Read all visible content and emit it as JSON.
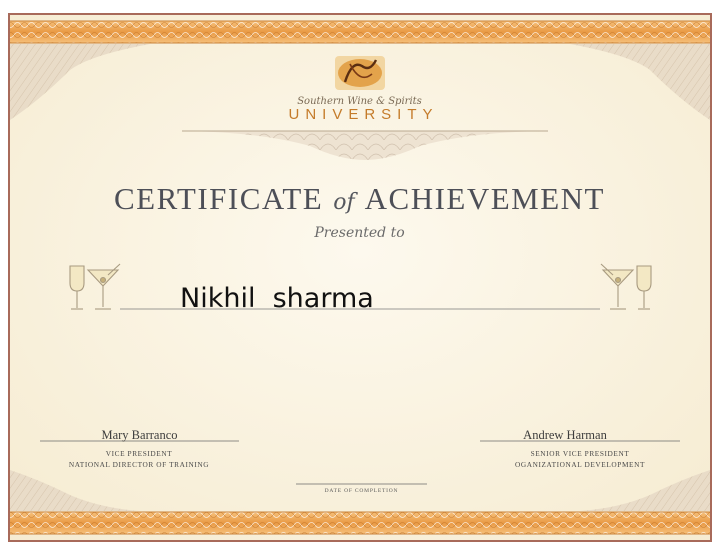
{
  "logo": {
    "monogram": "SWS",
    "tagline": "Southern Wine & Spirits",
    "name": "UNIVERSITY"
  },
  "certificate": {
    "title_left": "CERTIFICATE",
    "title_of": "of",
    "title_right": "ACHIEVEMENT",
    "presented_to": "Presented to",
    "recipient": "Nikhil  sharma"
  },
  "signatures": [
    {
      "name": "Mary Barranco",
      "title_line1": "VICE PRESIDENT",
      "title_line2": "NATIONAL DIRECTOR OF TRAINING"
    },
    {
      "name": "Andrew Harman",
      "title_line1": "SENIOR VICE PRESIDENT",
      "title_line2": "OGANIZATIONAL DEVELOPMENT"
    }
  ],
  "date_label": "DATE OF COMPLETION",
  "colors": {
    "parchment": "#fbf5e3",
    "border_orange": "#e9a04c",
    "frame_brown": "#a86a5a",
    "text_gray": "#4d4f57"
  }
}
